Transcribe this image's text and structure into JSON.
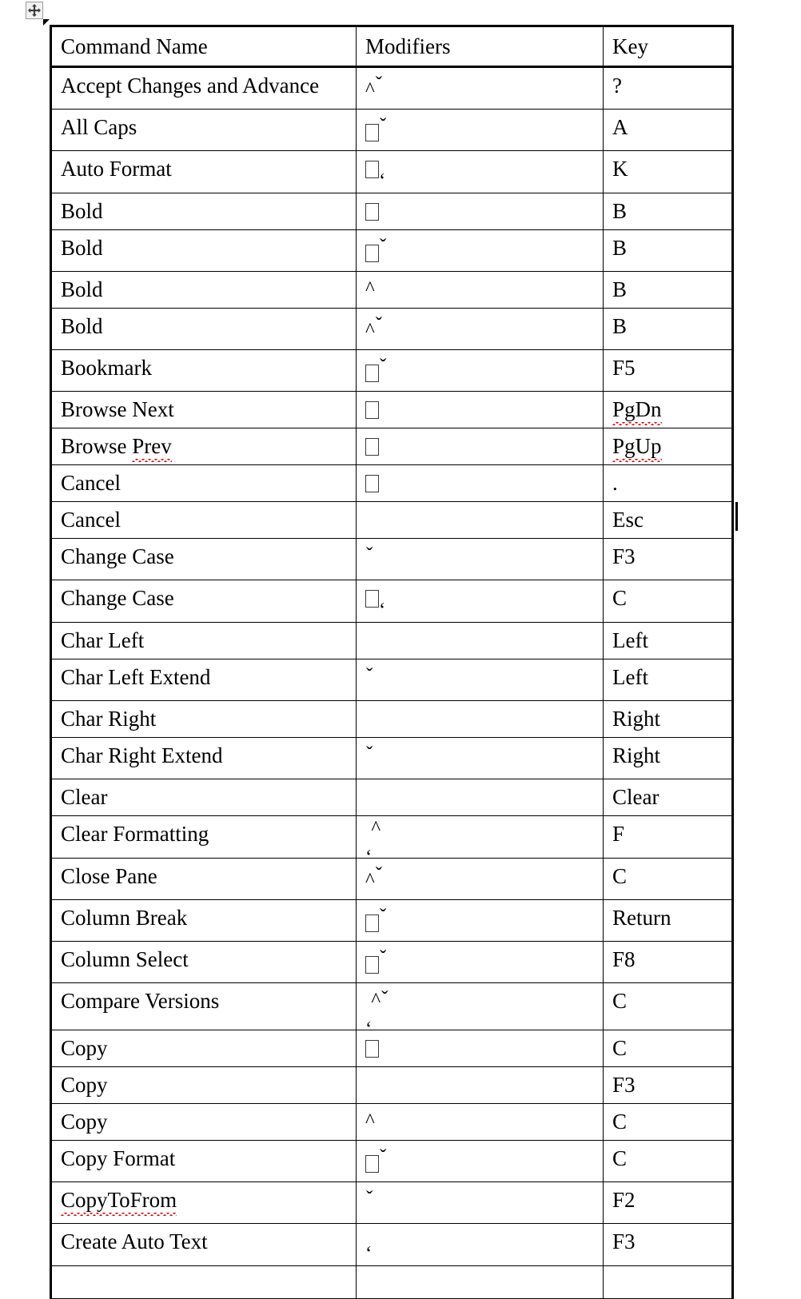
{
  "document": {
    "table_move_handle_icon": "move-4way-icon",
    "columns": [
      "Command Name",
      "Modifiers",
      "Key"
    ],
    "modifier_glyphs": {
      "control": "^",
      "shift": "ˇ",
      "option": "ʻ",
      "command": "□"
    },
    "rows": [
      {
        "command": "Accept Changes and Advance",
        "mods": [
          "control",
          "shift"
        ],
        "key": "?",
        "tall": true
      },
      {
        "command": "All Caps",
        "mods": [
          "command",
          "shift"
        ],
        "key": "A"
      },
      {
        "command": "Auto Format",
        "mods": [
          "command",
          "option"
        ],
        "key": "K"
      },
      {
        "command": "Bold",
        "mods": [
          "command"
        ],
        "key": "B"
      },
      {
        "command": "Bold",
        "mods": [
          "command",
          "shift"
        ],
        "key": "B"
      },
      {
        "command": "Bold",
        "mods": [
          "control"
        ],
        "key": "B"
      },
      {
        "command": "Bold",
        "mods": [
          "control",
          "shift"
        ],
        "key": "B"
      },
      {
        "command": "Bookmark",
        "mods": [
          "command",
          "shift"
        ],
        "key": "F5"
      },
      {
        "command": "Browse Next",
        "mods": [
          "command"
        ],
        "key": "PgDn",
        "key_misspelled": true
      },
      {
        "command": "Browse Prev",
        "mods": [
          "command"
        ],
        "key": "PgUp",
        "command_misspelled_word": "Prev",
        "key_misspelled": true
      },
      {
        "command": "Cancel",
        "mods": [
          "command"
        ],
        "key": "."
      },
      {
        "command": "Cancel",
        "mods": [],
        "key": "Esc"
      },
      {
        "command": "Change Case",
        "mods": [
          "shift"
        ],
        "key": "F3"
      },
      {
        "command": "Change Case",
        "mods": [
          "command",
          "option"
        ],
        "key": "C"
      },
      {
        "command": "Char Left",
        "mods": [],
        "key": "Left"
      },
      {
        "command": "Char Left Extend",
        "mods": [
          "shift"
        ],
        "key": "Left"
      },
      {
        "command": "Char Right",
        "mods": [],
        "key": "Right"
      },
      {
        "command": "Char Right Extend",
        "mods": [
          "shift"
        ],
        "key": "Right"
      },
      {
        "command": "Clear",
        "mods": [],
        "key": "Clear"
      },
      {
        "command": "Clear Formatting",
        "mods": [
          "option",
          "control"
        ],
        "key": "F",
        "stack": true
      },
      {
        "command": "Close Pane",
        "mods": [
          "control",
          "shift"
        ],
        "key": "C"
      },
      {
        "command": "Column Break",
        "mods": [
          "command",
          "shift"
        ],
        "key": "Return"
      },
      {
        "command": "Column Select",
        "mods": [
          "command",
          "shift"
        ],
        "key": "F8"
      },
      {
        "command": "Compare Versions",
        "mods": [
          "option",
          "control",
          "shift"
        ],
        "key": "C",
        "stack": true
      },
      {
        "command": "Copy",
        "mods": [
          "command"
        ],
        "key": "C"
      },
      {
        "command": "Copy",
        "mods": [],
        "key": "F3"
      },
      {
        "command": "Copy",
        "mods": [
          "control"
        ],
        "key": "C"
      },
      {
        "command": "Copy Format",
        "mods": [
          "command",
          "shift"
        ],
        "key": "C"
      },
      {
        "command": "CopyToFrom",
        "mods": [
          "shift"
        ],
        "key": "F2",
        "command_misspelled": true
      },
      {
        "command": "Create Auto Text",
        "mods": [
          "option"
        ],
        "key": "F3"
      },
      {
        "command": "",
        "mods": [],
        "key": "",
        "clipped": true
      }
    ]
  }
}
